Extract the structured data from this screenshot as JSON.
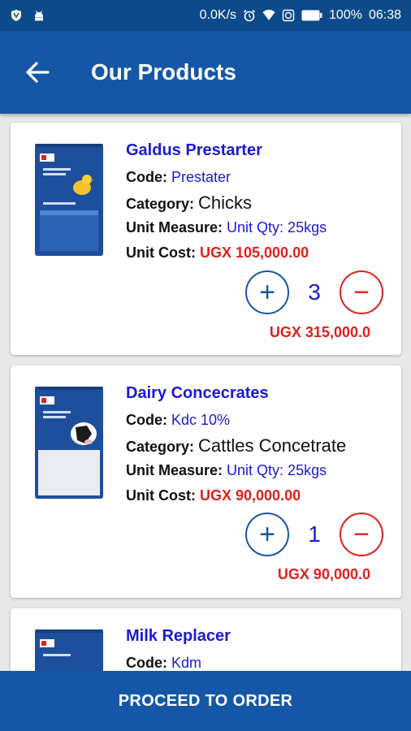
{
  "status_bar": {
    "network_speed": "0.0K/s",
    "battery": "100%",
    "time": "06:38"
  },
  "header": {
    "title": "Our Products"
  },
  "labels": {
    "code": "Code:",
    "category": "Category:",
    "unit_measure": "Unit Measure:",
    "unit_cost": "Unit Cost:"
  },
  "products": [
    {
      "name": "Galdus Prestarter",
      "code": "Prestater",
      "category": "Chicks",
      "unit_measure": "Unit Qty: 25kgs",
      "unit_cost": "UGX 105,000.00",
      "quantity": "3",
      "total": "UGX 315,000.0"
    },
    {
      "name": "Dairy Concecrates",
      "code": "Kdc 10%",
      "category": "Cattles Concetrate",
      "unit_measure": "Unit Qty: 25kgs",
      "unit_cost": "UGX 90,000.00",
      "quantity": "1",
      "total": "UGX 90,000.0"
    },
    {
      "name": "Milk Replacer",
      "code": "Kdm"
    }
  ],
  "footer": {
    "proceed_label": "PROCEED TO ORDER"
  },
  "colors": {
    "primary": "#1557a6",
    "status_bar": "#0d4a8a",
    "link_blue": "#1a1ad6",
    "price_red": "#e0201c"
  }
}
